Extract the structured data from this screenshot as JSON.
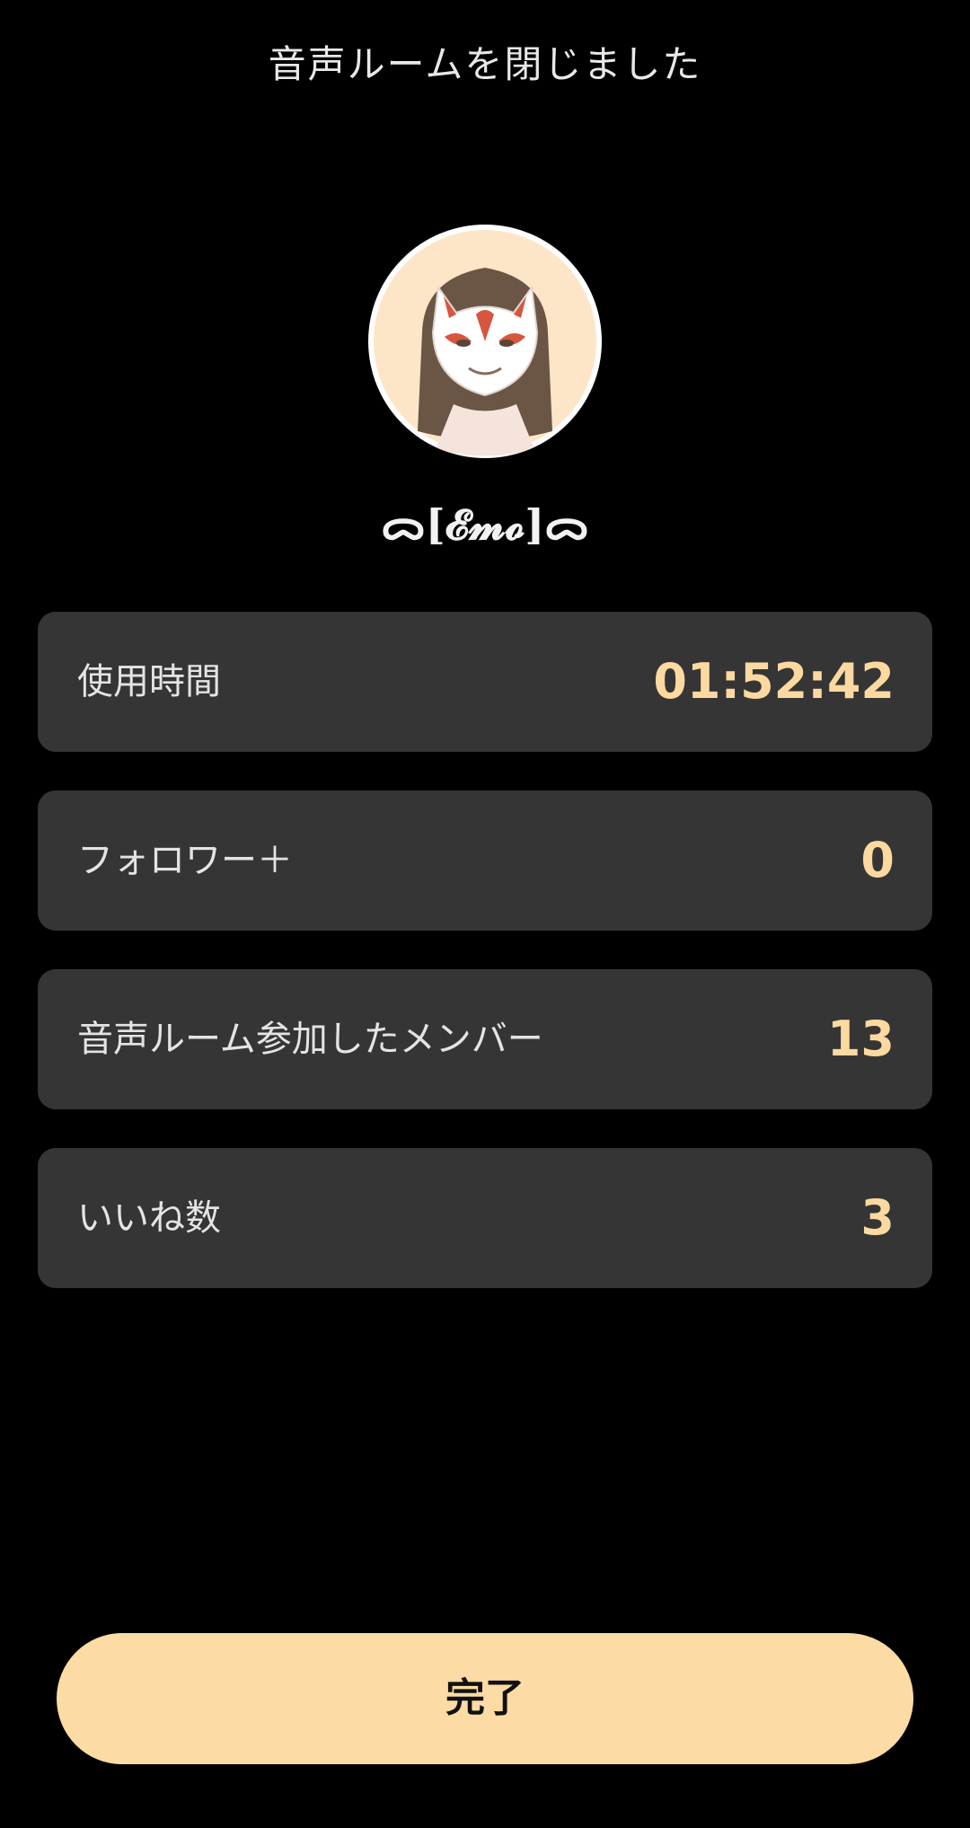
{
  "header": {
    "title": "音声ルームを閉じました"
  },
  "profile": {
    "username": "ᯅ[𝓔𝓶𝓸]ᯅ",
    "avatar_icon": "kitsune-mask-avatar-icon"
  },
  "stats": [
    {
      "label": "使用時間",
      "value": "01:52:42"
    },
    {
      "label": "フォロワー＋",
      "value": "0"
    },
    {
      "label": "音声ルーム参加したメンバー",
      "value": "13"
    },
    {
      "label": "いいね数",
      "value": "3"
    }
  ],
  "actions": {
    "done_label": "完了"
  },
  "colors": {
    "background": "#000000",
    "card": "#353535",
    "accent": "#fcd9a0",
    "button": "#fddba4"
  }
}
